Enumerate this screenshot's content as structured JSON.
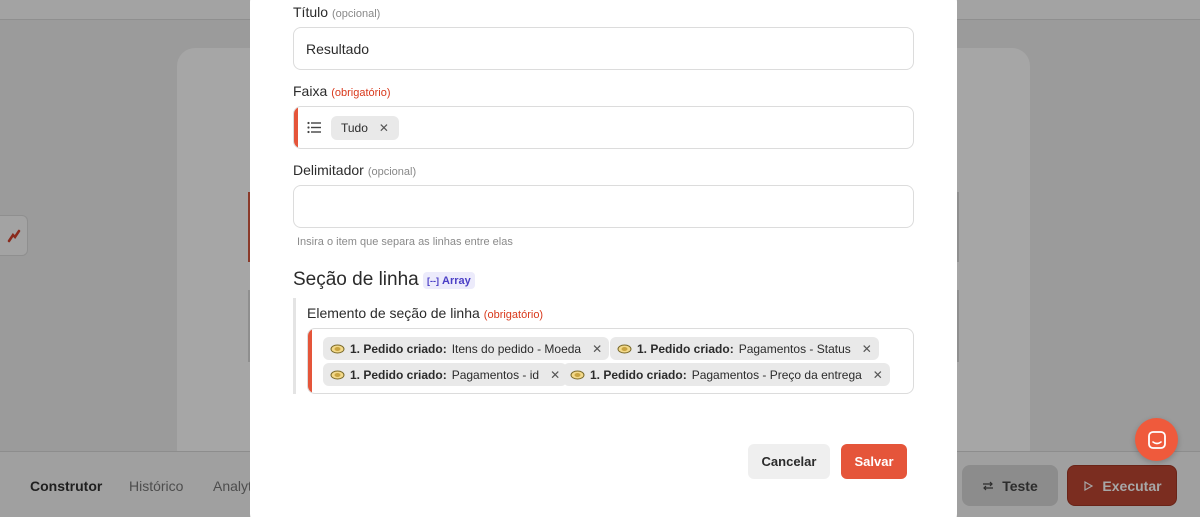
{
  "background": {
    "tabs": [
      "Construtor",
      "Histórico",
      "Analyt"
    ],
    "test_button": "Teste",
    "run_button": "Executar"
  },
  "modal": {
    "title_field": {
      "label": "Título",
      "hint": "(opcional)",
      "value": "Resultado"
    },
    "range_field": {
      "label": "Faixa",
      "hint": "(obrigatório)",
      "chip": "Tudo"
    },
    "delimiter_field": {
      "label": "Delimitador",
      "hint": "(opcional)",
      "value": "",
      "helper": "Insira o item que separa as linhas entre elas"
    },
    "row_section": {
      "title": "Seção de linha",
      "badge": "Array",
      "badge_icon": "[--]",
      "element_label": "Elemento de seção de linha",
      "element_hint": "(obrigatório)",
      "chips": [
        {
          "source": "1. Pedido criado:",
          "field": "Itens do pedido - Moeda"
        },
        {
          "source": "1. Pedido criado:",
          "field": "Pagamentos - Status"
        },
        {
          "source": "1. Pedido criado:",
          "field": "Pagamentos - id"
        },
        {
          "source": "1. Pedido criado:",
          "field": "Pagamentos - Preço da entrega"
        }
      ]
    },
    "cancel_button": "Cancelar",
    "save_button": "Salvar"
  },
  "colors": {
    "accent": "#e5553a",
    "required": "#d9391c",
    "array_badge": "#4b3fc6",
    "overlay": "#9b9b9b"
  },
  "icons": {
    "remove": "x-icon",
    "list": "list-icon",
    "chip_source": "egg-icon",
    "help": "chat-icon"
  }
}
